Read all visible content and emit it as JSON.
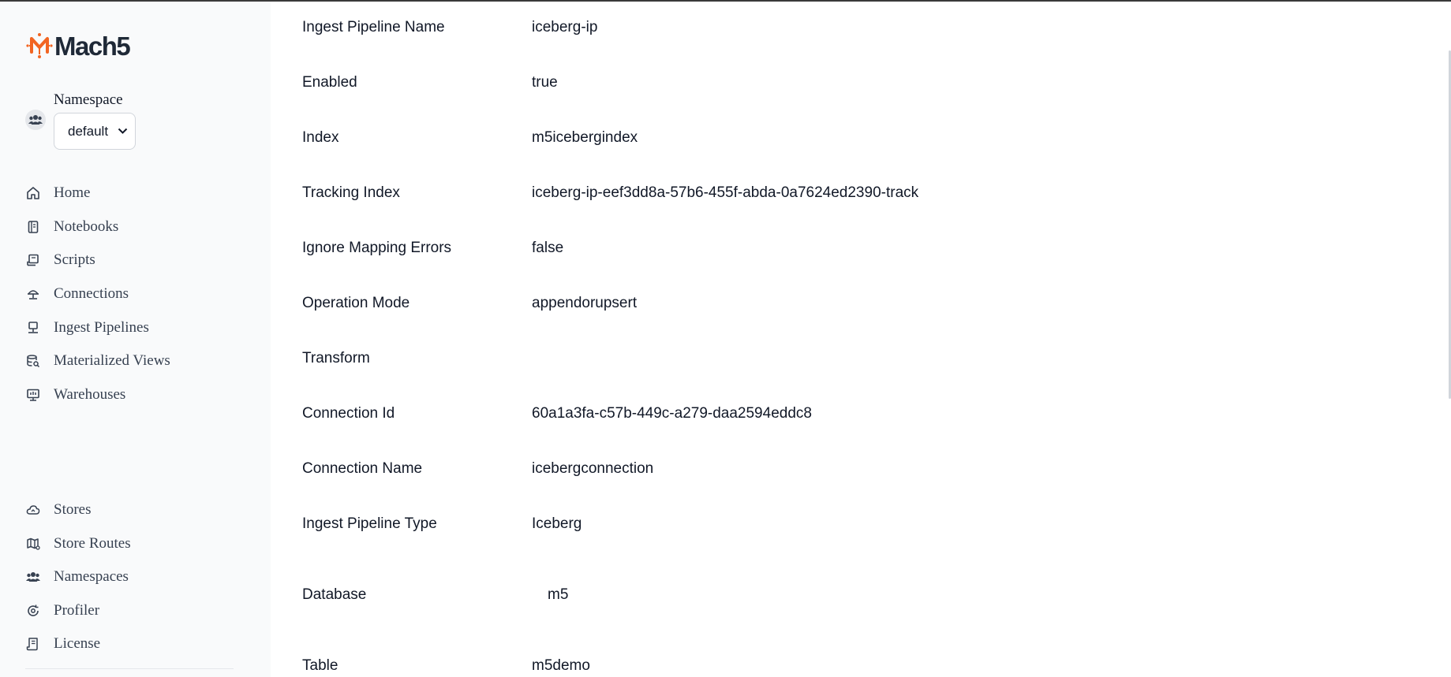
{
  "app": {
    "logo_text": "Mach5",
    "brand_color": "#f26522"
  },
  "namespace": {
    "label": "Namespace",
    "selected": "default"
  },
  "nav": {
    "top": [
      {
        "label": "Home",
        "icon": "home-icon"
      },
      {
        "label": "Notebooks",
        "icon": "notebook-icon"
      },
      {
        "label": "Scripts",
        "icon": "script-icon"
      },
      {
        "label": "Connections",
        "icon": "connection-icon"
      },
      {
        "label": "Ingest Pipelines",
        "icon": "pipeline-icon"
      },
      {
        "label": "Materialized Views",
        "icon": "database-search-icon"
      },
      {
        "label": "Warehouses",
        "icon": "warehouse-icon"
      }
    ],
    "bottom": [
      {
        "label": "Stores",
        "icon": "cloud-icon"
      },
      {
        "label": "Store Routes",
        "icon": "map-icon"
      },
      {
        "label": "Namespaces",
        "icon": "users-icon"
      },
      {
        "label": "Profiler",
        "icon": "profiler-icon"
      },
      {
        "label": "License",
        "icon": "license-icon"
      }
    ]
  },
  "details": [
    {
      "key": "Ingest Pipeline Name",
      "value": "iceberg-ip"
    },
    {
      "key": "Enabled",
      "value": "true"
    },
    {
      "key": "Index",
      "value": "m5icebergindex"
    },
    {
      "key": "Tracking Index",
      "value": "iceberg-ip-eef3dd8a-57b6-455f-abda-0a7624ed2390-track"
    },
    {
      "key": "Ignore Mapping Errors",
      "value": "false"
    },
    {
      "key": "Operation Mode",
      "value": "appendorupsert"
    },
    {
      "key": "Transform",
      "value": ""
    },
    {
      "key": "Connection Id",
      "value": "60a1a3fa-c57b-449c-a279-daa2594eddc8"
    },
    {
      "key": "Connection Name",
      "value": "icebergconnection"
    },
    {
      "key": "Ingest Pipeline Type",
      "value": "Iceberg"
    },
    {
      "key": "Database",
      "value": "m5"
    },
    {
      "key": "Table",
      "value": "m5demo"
    }
  ]
}
